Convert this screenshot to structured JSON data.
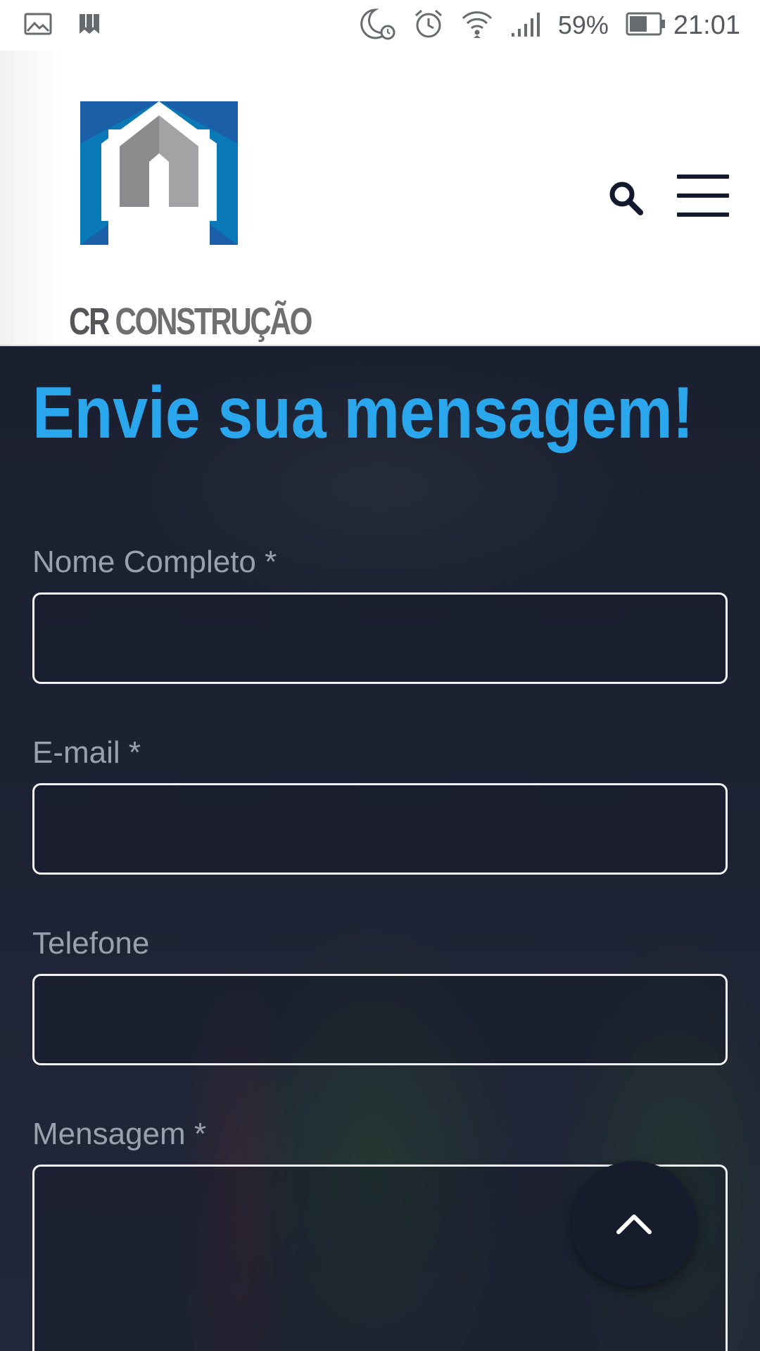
{
  "status_bar": {
    "battery_percent": "59%",
    "time": "21:01",
    "icons": [
      "image-icon",
      "bookmark-icon",
      "moon-alarm-icon",
      "alarm-icon",
      "wifi-icon",
      "signal-icon",
      "battery-icon"
    ]
  },
  "header": {
    "logo": {
      "part1": "CR",
      "part2": "CONSTRUÇÃO"
    },
    "search_icon": "search-icon",
    "menu_icon": "hamburger-menu-icon"
  },
  "form": {
    "title": "Envie sua mensagem!",
    "fields": [
      {
        "label": "Nome Completo *",
        "value": ""
      },
      {
        "label": "E-mail *",
        "value": ""
      },
      {
        "label": "Telefone",
        "value": ""
      },
      {
        "label": "Mensagem *",
        "value": ""
      }
    ]
  },
  "back_to_top_icon": "chevron-up-icon",
  "colors": {
    "title": "#2aa6ec",
    "background": "#1c2233",
    "header_bg": "#ffffff",
    "icon_dark": "#141a2e",
    "logo_blue": "#1a6db5",
    "logo_gray": "#6f6f72"
  }
}
